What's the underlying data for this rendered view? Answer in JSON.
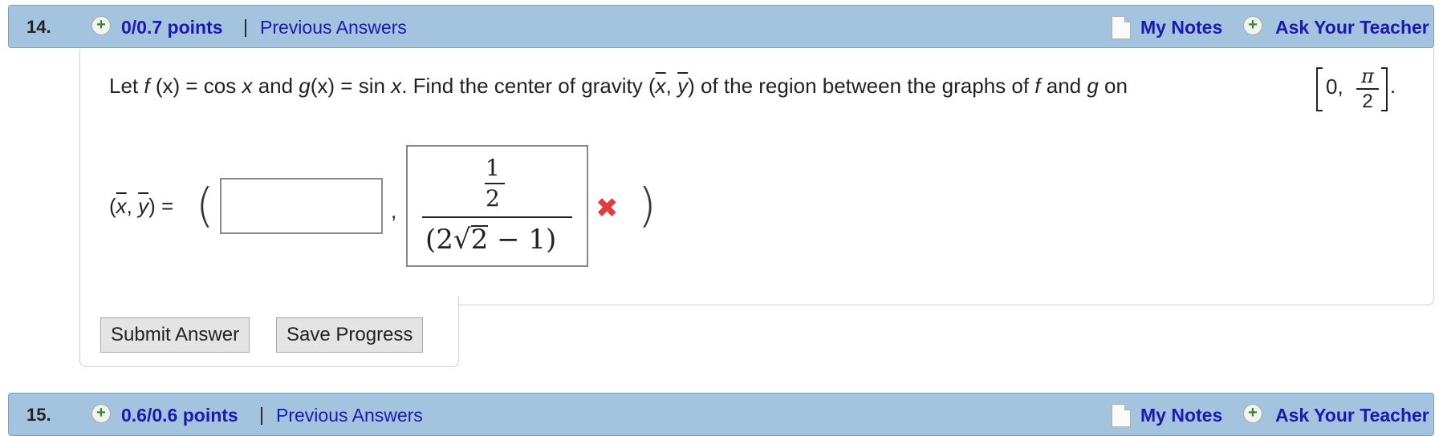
{
  "question14": {
    "number": "14.",
    "points": "0/0.7 points",
    "separator": "|",
    "previous_answers": "Previous Answers",
    "my_notes": "My Notes",
    "ask_teacher": "Ask Your Teacher",
    "prompt_part1": "Let ",
    "f": "f",
    "fx": " (x) = cos ",
    "x1": "x",
    "and1": " and ",
    "g": "g",
    "gx": "(x) = sin ",
    "x2": "x",
    "rest": ". Find the center of gravity (",
    "xbar": "x",
    "commaY": ", ",
    "ybar": "y",
    "rest2": ") of the region between the graphs of ",
    "f2": "f",
    "and2": " and ",
    "g2": "g",
    "on": " on",
    "interval_start": "0,",
    "pi": "π",
    "two": "2",
    "period": ".",
    "answer_lhs_open": "(",
    "answer_lhs_x": "x",
    "answer_lhs_comma": ", ",
    "answer_lhs_y": "y",
    "answer_lhs_close": ") =",
    "x_input_value": "",
    "y_answer_num": "1",
    "y_answer_num_den": "2",
    "y_answer_den_open": "(2",
    "y_answer_sqrt_sign": "√",
    "y_answer_sqrt": "2",
    "y_answer_den_rest": " − 1)",
    "incorrect_mark": "✖",
    "submit_label": "Submit Answer",
    "save_label": "Save Progress"
  },
  "question15": {
    "number": "15.",
    "points": "0.6/0.6 points",
    "separator": "|",
    "previous_answers": "Previous Answers",
    "my_notes": "My Notes",
    "ask_teacher": "Ask Your Teacher"
  },
  "colors": {
    "header_bg": "#a3c3df",
    "link": "#1a1ab0",
    "incorrect": "#e23d3d",
    "plus_icon": "#2e8b2e"
  }
}
